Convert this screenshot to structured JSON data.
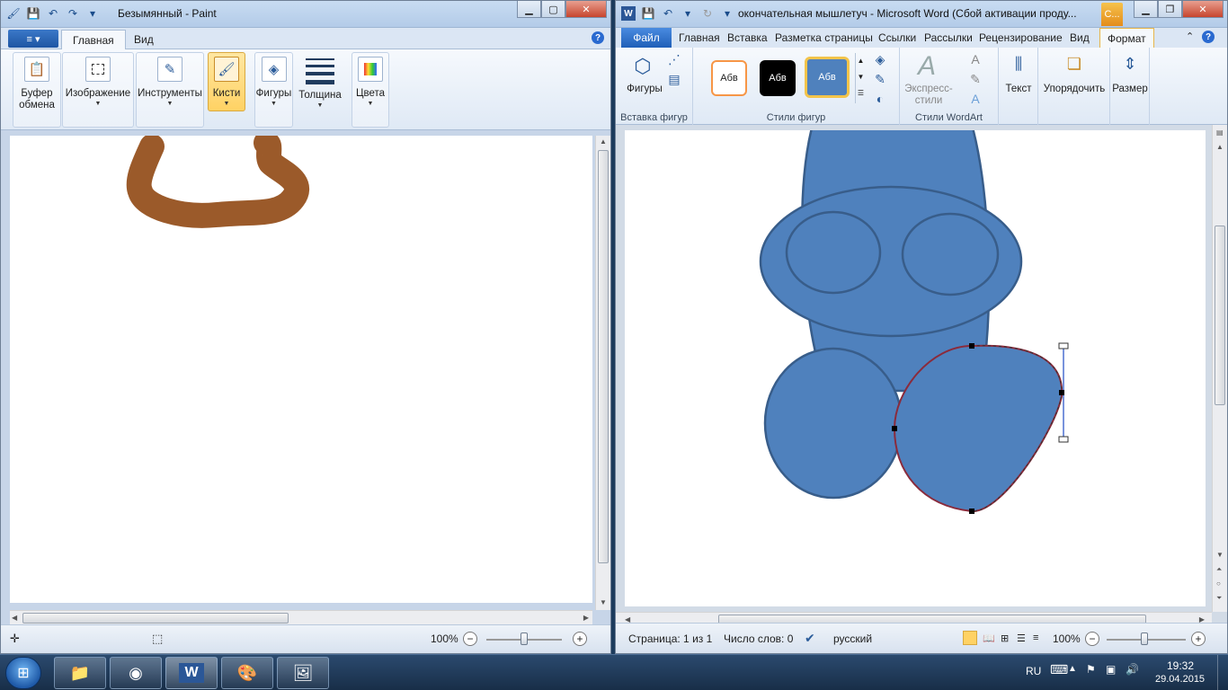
{
  "paint": {
    "window_title": "Безымянный - Paint",
    "menu_label": "≡ ▾",
    "tabs": [
      {
        "label": "Главная"
      },
      {
        "label": "Вид"
      }
    ],
    "groups": {
      "clipboard": "Буфер обмена",
      "image": "Изображение",
      "tools": "Инструменты",
      "brushes": "Кисти",
      "shapes": "Фигуры",
      "size": "Толщина",
      "colors": "Цвета"
    },
    "zoom": "100%",
    "colors": {
      "stroke": "#9b5a2a"
    }
  },
  "word": {
    "window_title": "окончательная мышлетуч - Microsoft Word (Сбой активации проду...",
    "context_tab_short": "С...",
    "file_tab": "Файл",
    "tabs": [
      {
        "label": "Главная"
      },
      {
        "label": "Вставка"
      },
      {
        "label": "Разметка страницы"
      },
      {
        "label": "Ссылки"
      },
      {
        "label": "Рассылки"
      },
      {
        "label": "Рецензирование"
      },
      {
        "label": "Вид"
      },
      {
        "label": "Формат"
      }
    ],
    "ribbon": {
      "shapes_button": "Фигуры",
      "insert_shapes_group": "Вставка фигур",
      "style_swatch": "Абв",
      "shape_styles_group": "Стили фигур",
      "express_styles": "Экспресс-стили",
      "wordart_group": "Стили WordArt",
      "text": "Текст",
      "arrange": "Упорядочить",
      "size": "Размер"
    },
    "status": {
      "page": "Страница: 1 из 1",
      "words": "Число слов: 0",
      "language": "русский",
      "zoom": "100%"
    },
    "colors": {
      "shape_fill": "#4f81bd",
      "shape_outline": "#385d8a",
      "selected_outline": "#8a2b3c"
    }
  },
  "taskbar": {
    "language": "RU",
    "time": "19:32",
    "date": "29.04.2015"
  }
}
